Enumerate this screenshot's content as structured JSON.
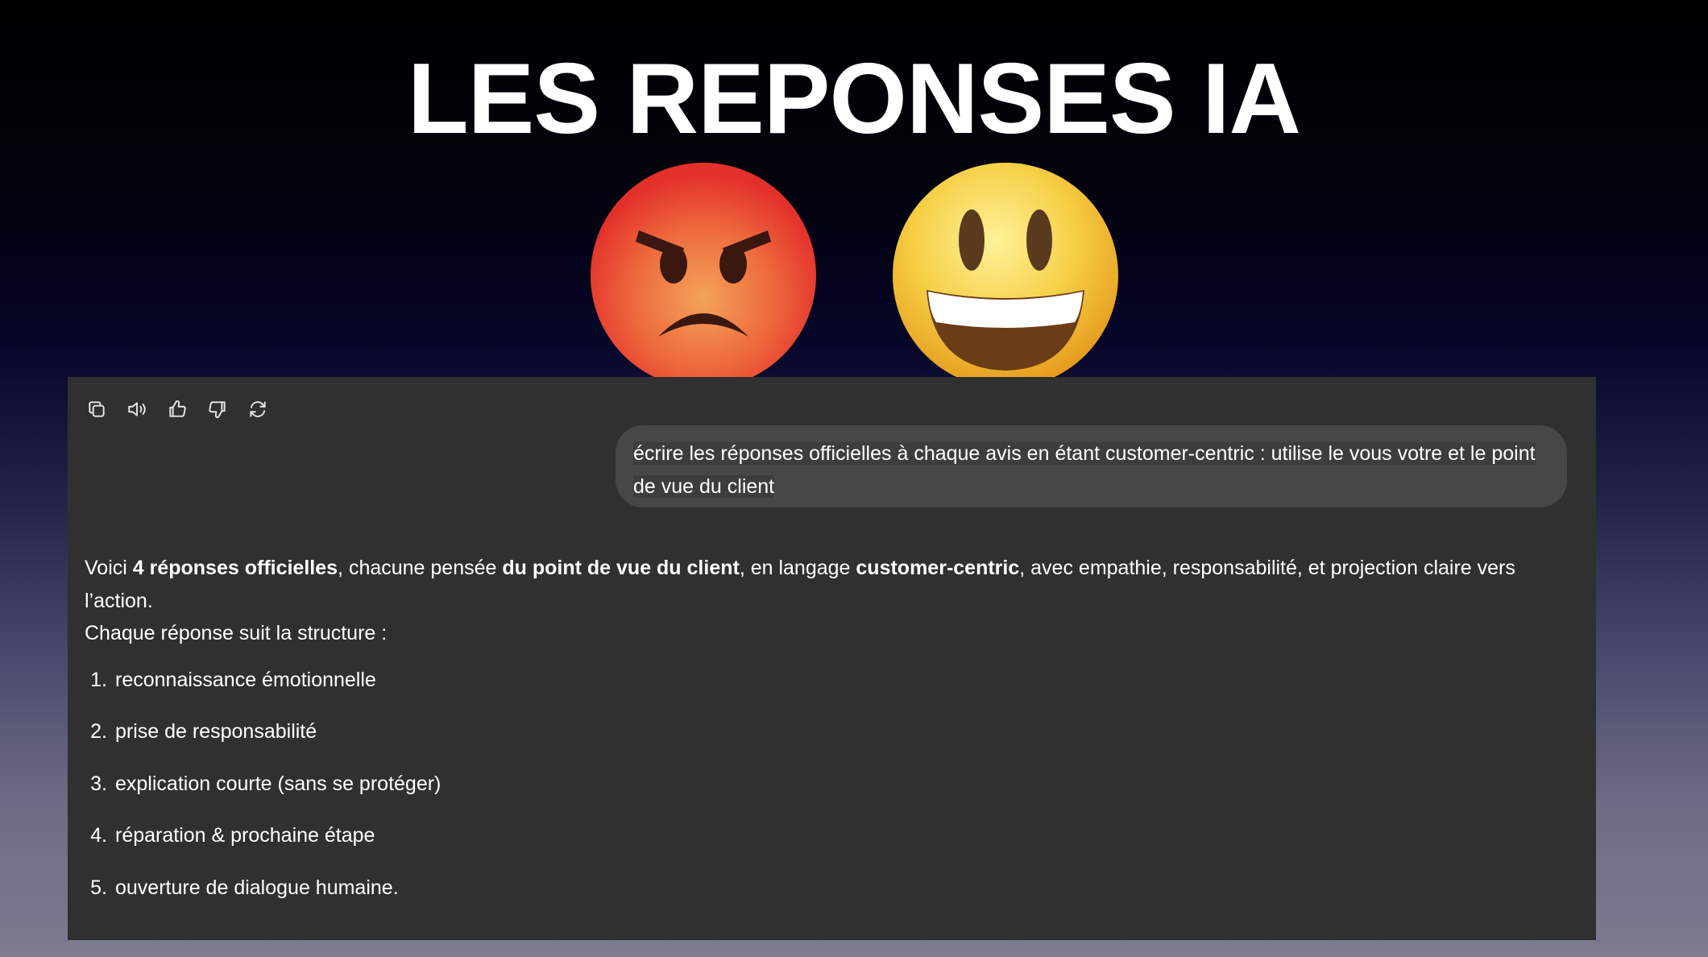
{
  "slide": {
    "title": "LES REPONSES IA"
  },
  "emojis": [
    {
      "name": "angry-face-emoji",
      "color": "#e8453a"
    },
    {
      "name": "grinning-face-emoji",
      "color": "#f5c93c"
    }
  ],
  "toolbar": {
    "icons": [
      "copy-icon",
      "read-aloud-icon",
      "thumbs-up-icon",
      "thumbs-down-icon",
      "regenerate-icon"
    ]
  },
  "user_message": {
    "text": "écrire les réponses officielles à chaque avis en étant customer-centric : utilise le vous votre et le point de vue du client"
  },
  "assistant_message": {
    "intro_parts": [
      {
        "text": "Voici ",
        "bold": false
      },
      {
        "text": "4 réponses officielles",
        "bold": true
      },
      {
        "text": ", chacune pensée ",
        "bold": false
      },
      {
        "text": "du point de vue du client",
        "bold": true
      },
      {
        "text": ", en langage ",
        "bold": false
      },
      {
        "text": "customer-centric",
        "bold": true
      },
      {
        "text": ", avec empathie, responsabilité, et projection claire vers l’action.",
        "bold": false
      }
    ],
    "structure_line": "Chaque réponse suit la structure :",
    "steps": [
      {
        "number": "1.",
        "label": "reconnaissance émotionnelle"
      },
      {
        "number": "2.",
        "label": "prise de responsabilité"
      },
      {
        "number": "3.",
        "label": "explication courte (sans se protéger)"
      },
      {
        "number": "4.",
        "label": "réparation & prochaine étape"
      },
      {
        "number": "5.",
        "label": "ouverture de dialogue humaine."
      }
    ]
  },
  "colors": {
    "panel": "#303030",
    "bubble": "#474747",
    "text": "#ffffff"
  }
}
